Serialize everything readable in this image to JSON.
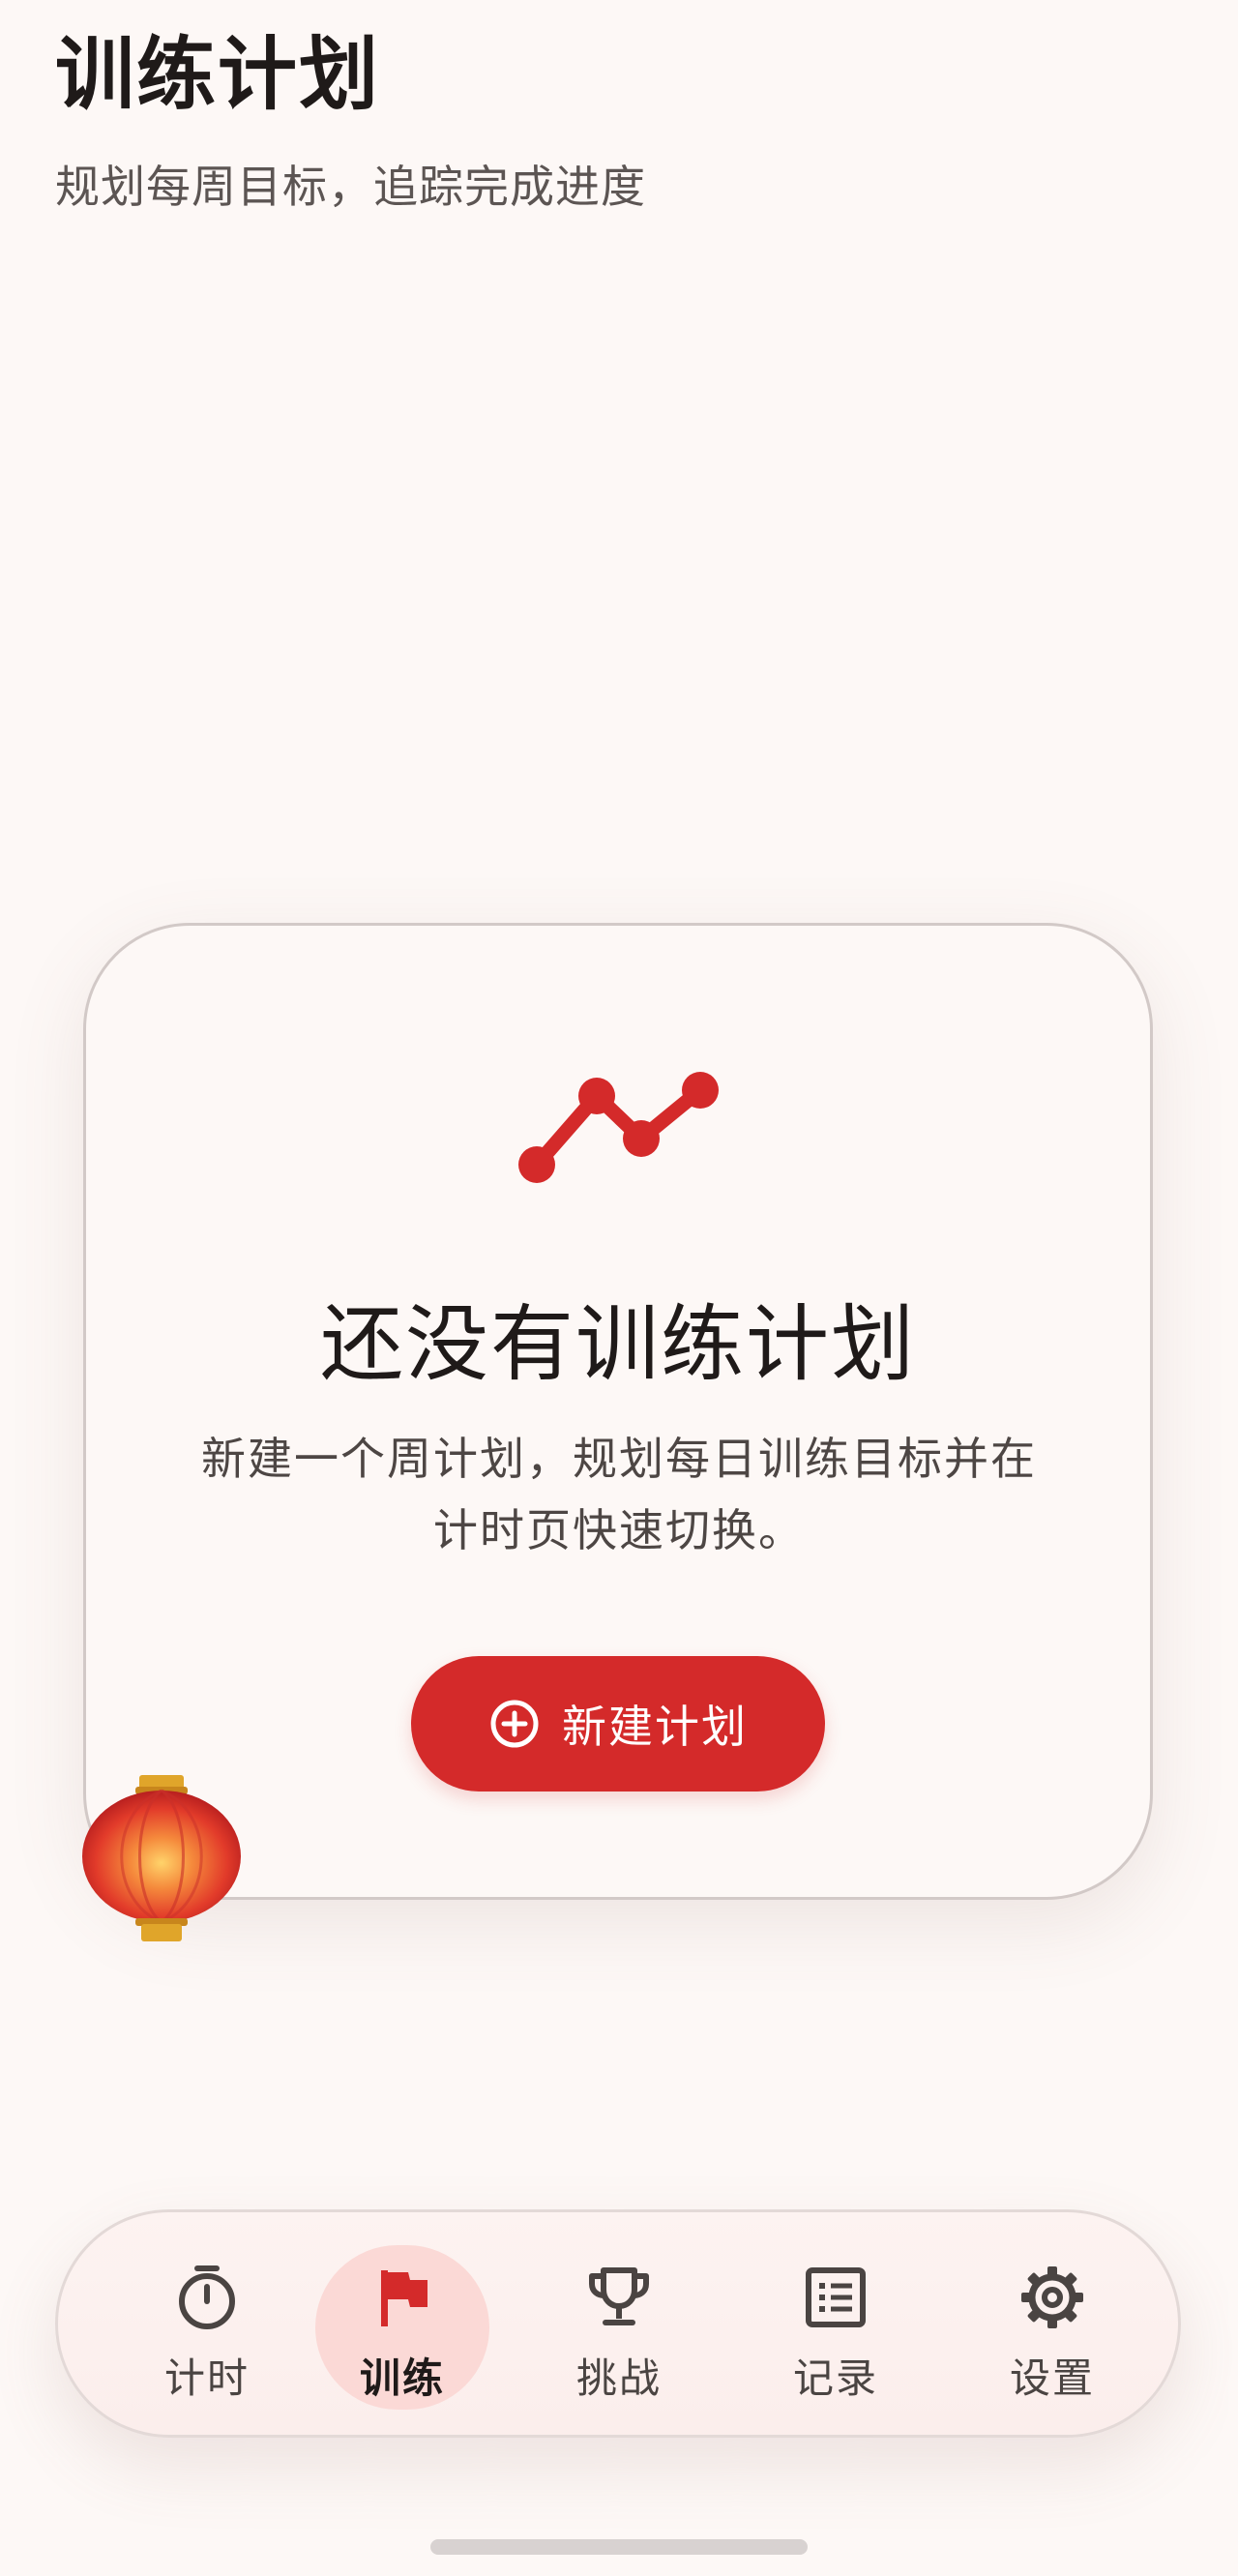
{
  "header": {
    "title": "训练计划",
    "subtitle": "规划每周目标，追踪完成进度"
  },
  "empty_state": {
    "icon": "trend-line-icon",
    "title": "还没有训练计划",
    "description": "新建一个周计划，规划每日训练目标并在计时页快速切换。",
    "button_label": "新建计划",
    "button_icon": "add-circle-icon"
  },
  "decoration": {
    "icon": "red-lantern-icon"
  },
  "bottom_nav": {
    "items": [
      {
        "label": "计时",
        "icon": "stopwatch-icon",
        "active": false
      },
      {
        "label": "训练",
        "icon": "flag-icon",
        "active": true
      },
      {
        "label": "挑战",
        "icon": "trophy-icon",
        "active": false
      },
      {
        "label": "记录",
        "icon": "list-icon",
        "active": false
      },
      {
        "label": "设置",
        "icon": "gear-icon",
        "active": false
      }
    ]
  },
  "colors": {
    "accent": "#d42a2a",
    "background": "#fdf8f6",
    "active_pill": "#fbd9d6",
    "text_primary": "#1f1a19",
    "text_secondary": "#5c5553"
  }
}
